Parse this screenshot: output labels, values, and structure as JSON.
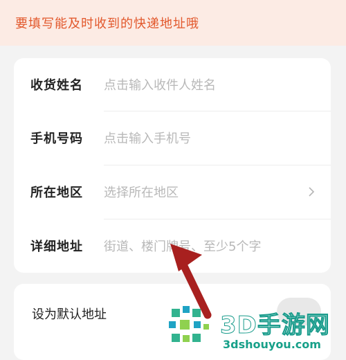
{
  "notice": {
    "text": "要填写能及时收到的快递地址哦"
  },
  "form": {
    "rows": [
      {
        "label": "收货姓名",
        "placeholder": "点击输入收件人姓名"
      },
      {
        "label": "手机号码",
        "placeholder": "点击输入手机号"
      },
      {
        "label": "所在地区",
        "placeholder": "选择所在地区"
      },
      {
        "label": "详细地址",
        "placeholder": "街道、楼门牌号、至少5个字"
      }
    ]
  },
  "default_address": {
    "label": "设为默认地址",
    "enabled": false
  },
  "watermark": {
    "brand": "3D手游网",
    "url": "3dshouyou.com"
  },
  "colors": {
    "accent": "#e2582c",
    "arrow": "#a8201f",
    "watermark": "#17a089"
  }
}
